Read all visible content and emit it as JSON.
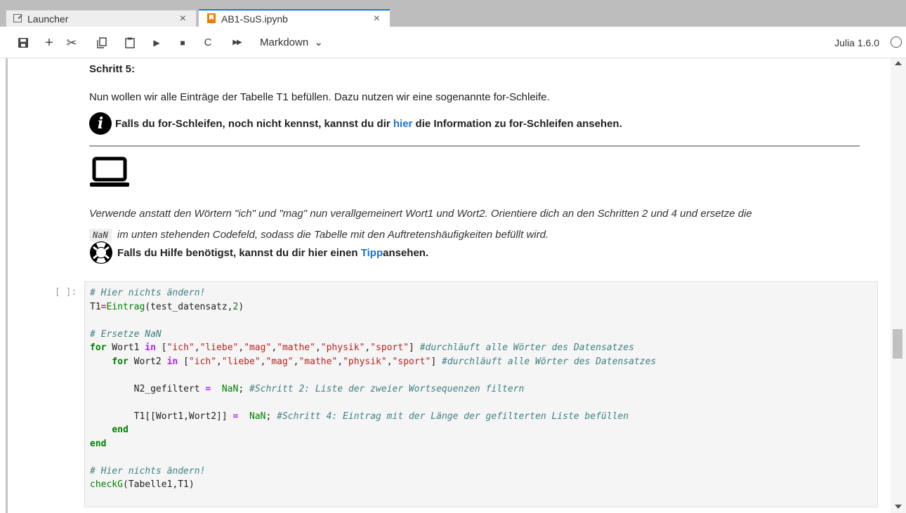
{
  "tabs": [
    {
      "label": "Launcher",
      "icon": "launcher-icon",
      "close": "×"
    },
    {
      "label": "AB1-SuS.ipynb",
      "icon": "notebook-icon",
      "close": "×"
    }
  ],
  "toolbar": {
    "buttons": {
      "save": "save-icon",
      "add": "+",
      "cut": "✂",
      "copy": "copy-icon",
      "paste": "paste-icon",
      "run": "▶",
      "stop": "■",
      "restart": "C",
      "run_all": "▶▶"
    },
    "cell_type": "Markdown",
    "cell_type_arrow": "⌄",
    "kernel_name": "Julia 1.6.0"
  },
  "markdown": {
    "heading": "Schritt 5:",
    "intro": "Nun wollen wir alle Einträge der Tabelle T1 befüllen. Dazu nutzen wir eine sogenannte for-Schleife.",
    "info_icon_glyph": "i",
    "info_before": "Falls du for-Schleifen, noch nicht kennst, kannst du dir ",
    "info_link": "hier",
    "info_after": " die Information zu for-Schleifen ansehen.",
    "task_line1": "Verwende anstatt den Wörtern \"ich\" und \"mag\" nun verallgemeinert Wort1 und Wort2. Orientiere dich an den Schritten 2 und 4 und ersetze die",
    "task_code": "NaN",
    "task_line2": "im unten stehenden Codefeld, sodass die Tabelle mit den Auftretenshäufigkeiten befüllt wird.",
    "help_before": "Falls du Hilfe benötigst, kannst du dir hier einen ",
    "help_link": "Tipp",
    "help_after": " ansehen."
  },
  "code_cell": {
    "prompt": "[ ]:",
    "lines": {
      "c1": "# Hier nichts ändern!",
      "l2_var": "T1",
      "l2_eq": "=",
      "l2_fn": "Eintrag",
      "l2_args": "(test_datensatz,",
      "l2_num": "2",
      "l2_close": ")",
      "c4": "# Ersetze NaN",
      "for_kw": "for",
      "wort1": " Wort1 ",
      "wort2": " Wort2 ",
      "in_kw": "in",
      "list_open": " [",
      "s_ich": "\"ich\"",
      "s_liebe": "\"liebe\"",
      "s_mag": "\"mag\"",
      "s_mathe": "\"mathe\"",
      "s_physik": "\"physik\"",
      "s_sport": "\"sport\"",
      "comma": ",",
      "list_close": "] ",
      "loop_comment": "#durchläuft alle Wörter des Datensatzes",
      "n2_var": "N2_gefiltert ",
      "assign": "=",
      "nan": "NaN",
      "semi": ";",
      "n2_comment": "#Schritt 2: Liste der zweier Wortsequenzen filtern",
      "t1_var": "T1[[Wort1,Wort2]] ",
      "t1_comment": "#Schritt 4: Eintrag mit der Länge der gefilterten Liste befüllen",
      "end_kw": "end",
      "c_last": "# Hier nichts ändern!",
      "check_fn": "checkG",
      "check_args": "(Tabelle1,T1)"
    }
  }
}
